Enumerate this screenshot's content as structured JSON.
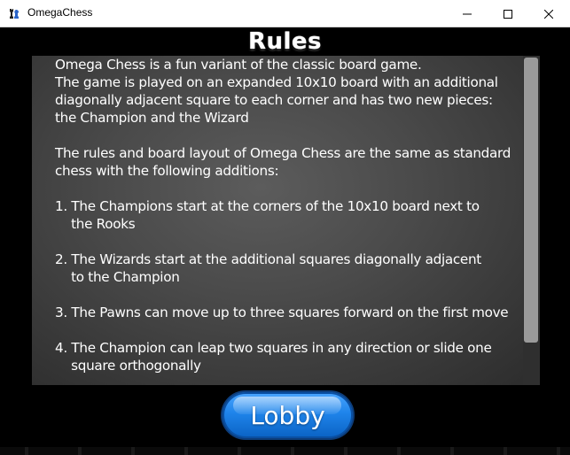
{
  "window": {
    "title": "OmegaChess",
    "icon": "chess-pieces-icon"
  },
  "heading": "Rules",
  "rules": {
    "intro": [
      "Omega Chess is a fun variant of the classic board game.",
      "The game is played on an expanded 10x10 board with an additional",
      "diagonally adjacent square to each corner and has two new pieces:",
      "the Champion and the Wizard"
    ],
    "paragraph2": [
      "The rules and board layout of Omega Chess are the same as standard",
      "chess with the following additions:"
    ],
    "items": [
      [
        "1. The Champions start at the corners of the 10x10 board next to",
        "    the Rooks"
      ],
      [
        "2. The Wizards start at the additional squares diagonally adjacent",
        "    to the Champion"
      ],
      [
        "3. The Pawns can move up to three squares forward on the first move"
      ],
      [
        "4. The Champion can leap two squares in any direction or slide one",
        "    square orthogonally"
      ]
    ]
  },
  "lobby_button": {
    "label": "Lobby",
    "color": "#1f84ea"
  },
  "colors": {
    "background": "#000000",
    "panel": "#4a4a4a",
    "text": "#ffffff"
  }
}
